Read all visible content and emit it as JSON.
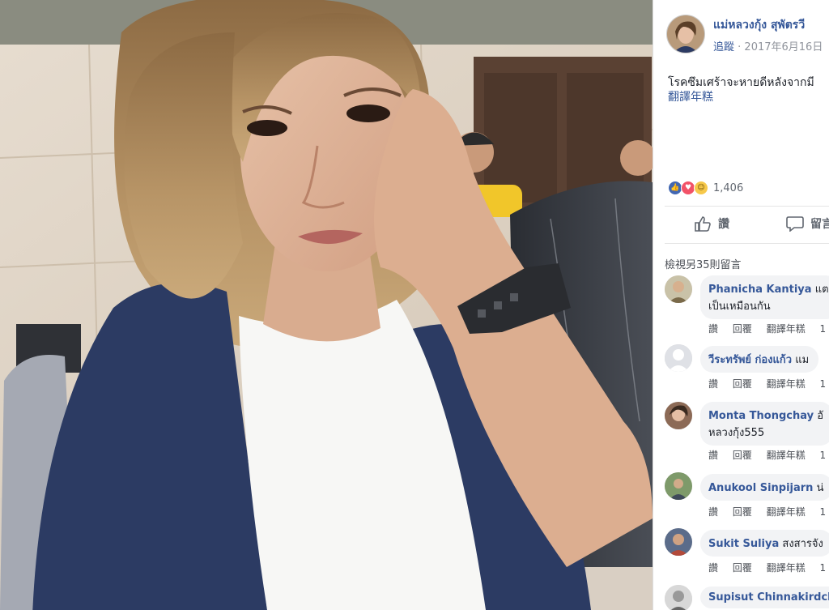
{
  "post": {
    "author": "แม่หลวงกุ้ง สุพัตรวี",
    "follow": "追蹤",
    "date": "2017年6月16日",
    "text": "โรคซึมเศร้าจะหายดีหลังจากมี",
    "see_translation": "翻譯年糕",
    "reaction_count": "1,406",
    "reaction_icons": [
      "like-icon",
      "love-icon",
      "haha-icon"
    ]
  },
  "actions": {
    "like": "讚",
    "comment": "留言"
  },
  "comments_header": "檢視另35則留言",
  "comment_actions": {
    "like": "讚",
    "reply": "回覆",
    "translate": "翻譯年糕",
    "time_prefix": "1"
  },
  "comments": [
    {
      "name": "Phanicha Kantiya",
      "text": "แต",
      "line2": "เป็นเหมือนกัน"
    },
    {
      "name": "วีระทรัพย์ ก่องแก้ว",
      "text": "แม",
      "line2": ""
    },
    {
      "name": "Monta Thongchay",
      "text": "อั",
      "line2": "หลวงกุ้ง555"
    },
    {
      "name": "Anukool Sinpijarn",
      "text": "น่",
      "line2": ""
    },
    {
      "name": "Sukit Suliya",
      "text": "สงสารจัง",
      "line2": ""
    },
    {
      "name": "Supisut Chinnakirdch",
      "text": "",
      "line2": ""
    }
  ],
  "colors": {
    "link": "#365899",
    "muted": "#90949c",
    "bubble": "#f2f3f5",
    "jacket": "#2c3b63",
    "shirt": "#f7f7f5"
  }
}
